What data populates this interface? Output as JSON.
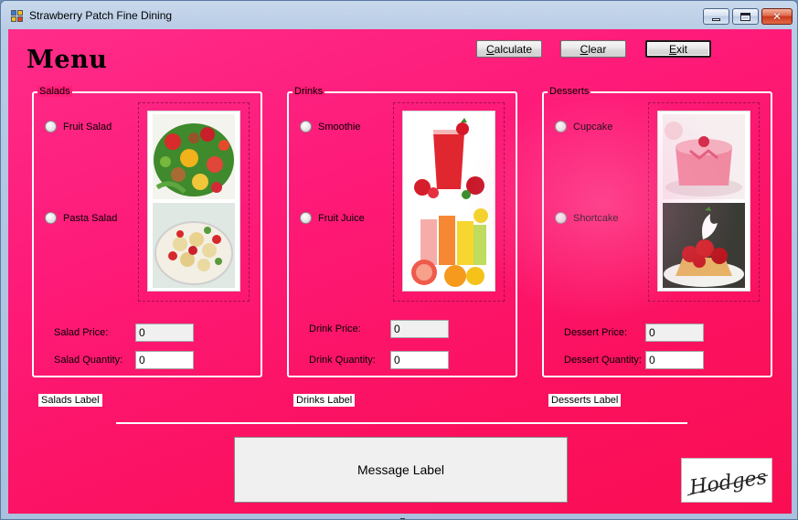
{
  "window": {
    "title": "Strawberry Patch Fine Dining",
    "controls": {
      "minimize": "minimize-icon",
      "maximize": "maximize-icon",
      "close": "close-icon"
    }
  },
  "header": {
    "menu_title": "Menu"
  },
  "toolbar": {
    "calculate": {
      "mnemonic": "C",
      "rest": "alculate"
    },
    "clear": {
      "mnemonic": "C",
      "rest": "lear"
    },
    "exit": {
      "mnemonic": "E",
      "rest": "xit"
    }
  },
  "groups": {
    "salads": {
      "caption": "Salads",
      "option1": "Fruit Salad",
      "option2": "Pasta Salad",
      "price_label": "Salad Price:",
      "price_value": "0",
      "qty_label": "Salad Quantity:",
      "qty_value": "0",
      "output_label": "Salads Label"
    },
    "drinks": {
      "caption": "Drinks",
      "option1": "Smoothie",
      "option2": "Fruit Juice",
      "price_label": "Drink Price:",
      "price_value": "0",
      "qty_label": "Drink Quantity:",
      "qty_value": "0",
      "output_label": "Drinks Label"
    },
    "desserts": {
      "caption": "Desserts",
      "option1": "Cupcake",
      "option2": "Shortcake",
      "price_label": "Dessert Price:",
      "price_value": "0",
      "qty_label": "Dessert Quantity:",
      "qty_value": "0",
      "output_label": "Desserts Label"
    }
  },
  "message": {
    "text": "Message Label"
  },
  "logo": {
    "signature": "Hodges"
  },
  "colors": {
    "background_pink": "#fe1a78",
    "groupbox_border": "#ffffff",
    "readonly_field": "#f0f0f0"
  }
}
